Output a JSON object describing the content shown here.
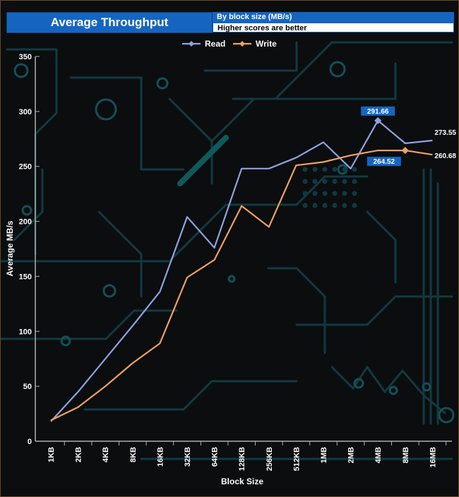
{
  "header": {
    "title": "Average Throughput",
    "subtitle": "By block size (MB/s)",
    "note": "Higher scores are better"
  },
  "chart_data": {
    "type": "line",
    "categories": [
      "1KB",
      "2KB",
      "4KB",
      "8KB",
      "16KB",
      "32KB",
      "64KB",
      "128KB",
      "256KB",
      "512KB",
      "1MB",
      "2MB",
      "4MB",
      "8MB",
      "16MB"
    ],
    "ylim": [
      0,
      350
    ],
    "yticks": [
      0,
      50,
      100,
      150,
      200,
      250,
      300,
      350
    ],
    "xlabel": "Block Size",
    "ylabel": "Average MB/s",
    "legend": "top-center",
    "grid": false,
    "series": [
      {
        "name": "Read",
        "color": "#8fa2e0",
        "values": [
          18,
          45,
          75,
          105,
          136,
          204,
          176,
          248,
          248,
          258,
          272,
          248,
          291.66,
          271,
          273.55
        ]
      },
      {
        "name": "Write",
        "color": "#f0a060",
        "values": [
          19,
          31,
          50,
          71,
          89,
          149,
          165,
          214,
          195,
          251,
          254,
          260,
          264.52,
          264.52,
          260.68
        ]
      }
    ],
    "annotations": [
      {
        "label": "291.66",
        "series": "Read",
        "index": 12,
        "style": "badge"
      },
      {
        "label": "273.55",
        "series": "Read",
        "index": 14,
        "style": "plain"
      },
      {
        "label": "264.52",
        "series": "Write",
        "index": 13,
        "style": "badge"
      },
      {
        "label": "260.68",
        "series": "Write",
        "index": 14,
        "style": "plain"
      }
    ]
  }
}
